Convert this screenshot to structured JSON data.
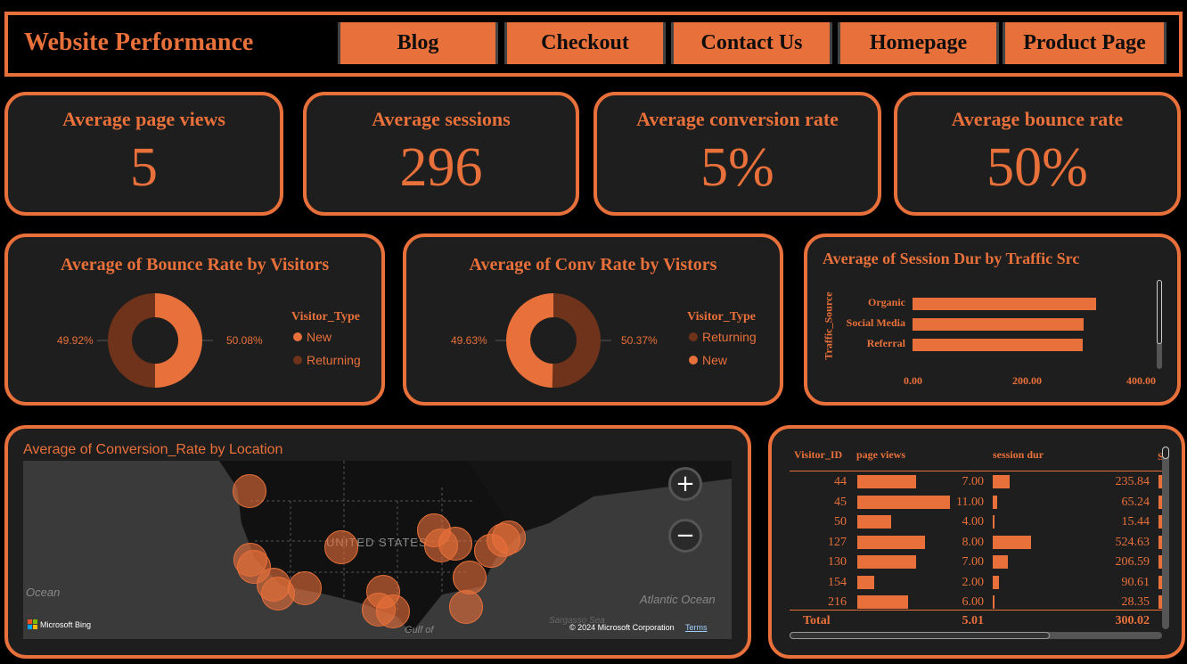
{
  "header": {
    "title": "Website Performance",
    "nav": [
      "Blog",
      "Checkout",
      "Contact Us",
      "Homepage",
      "Product Page"
    ]
  },
  "kpis": [
    {
      "title": "Average page views",
      "value": "5"
    },
    {
      "title": "Average sessions",
      "value": "296"
    },
    {
      "title": "Average conversion rate",
      "value": "5%"
    },
    {
      "title": "Average bounce rate",
      "value": "50%"
    }
  ],
  "colors": {
    "accent": "#e8703a",
    "dark_accent": "#6e331a",
    "panel": "#1e1e1e"
  },
  "bounce_donut": {
    "title": "Average of Bounce Rate by Visitors",
    "legend_title": "Visitor_Type",
    "left_label": "49.92%",
    "right_label": "50.08%",
    "legend": [
      "New",
      "Returning"
    ]
  },
  "conv_donut": {
    "title": "Average of Conv Rate by Vistors",
    "legend_title": "Visitor_Type",
    "left_label": "49.63%",
    "right_label": "50.37%",
    "legend": [
      "Returning",
      "New"
    ]
  },
  "traffic_chart": {
    "title": "Average of Session Dur by Traffic Src",
    "ylabel": "Traffic_Source",
    "ticks": [
      "0.00",
      "200.00",
      "400.00"
    ]
  },
  "map": {
    "title": "Average of Conversion_Rate by Location",
    "country_label": "UNITED STATES",
    "ocean_left": "Ocean",
    "ocean_right": "Atlantic Ocean",
    "gulf_label": "Gulf of",
    "sargasso_label": "Sargasso Sea",
    "bing": "Microsoft Bing",
    "copyright": "© 2024 Microsoft Corporation",
    "terms": "Terms",
    "zoom_in": "+",
    "zoom_out": "−"
  },
  "table": {
    "columns": [
      "Visitor_ID",
      "page views",
      "session dur",
      "S"
    ],
    "rows": [
      {
        "id": "44",
        "pv": "7.00",
        "sd": "235.84"
      },
      {
        "id": "45",
        "pv": "11.00",
        "sd": "65.24"
      },
      {
        "id": "50",
        "pv": "4.00",
        "sd": "15.44"
      },
      {
        "id": "127",
        "pv": "8.00",
        "sd": "524.63"
      },
      {
        "id": "130",
        "pv": "7.00",
        "sd": "206.59"
      },
      {
        "id": "154",
        "pv": "2.00",
        "sd": "90.61"
      },
      {
        "id": "216",
        "pv": "6.00",
        "sd": "28.35"
      }
    ],
    "total_label": "Total",
    "total_pv": "5.01",
    "total_sd": "300.02"
  },
  "chart_data": [
    {
      "type": "pie",
      "title": "Average of Bounce Rate by Visitors",
      "legend_title": "Visitor_Type",
      "series": [
        {
          "name": "New",
          "value": 50.08,
          "color": "#e8703a"
        },
        {
          "name": "Returning",
          "value": 49.92,
          "color": "#6e331a"
        }
      ]
    },
    {
      "type": "pie",
      "title": "Average of Conv Rate by Vistors",
      "legend_title": "Visitor_Type",
      "series": [
        {
          "name": "Returning",
          "value": 50.37,
          "color": "#6e331a"
        },
        {
          "name": "New",
          "value": 49.63,
          "color": "#e8703a"
        }
      ]
    },
    {
      "type": "bar",
      "orientation": "horizontal",
      "title": "Average of Session Dur by Traffic Src",
      "ylabel": "Traffic_Source",
      "categories": [
        "Organic",
        "Social Media",
        "Referral"
      ],
      "values": [
        322,
        300,
        299
      ],
      "xlim": [
        0,
        400
      ]
    }
  ]
}
